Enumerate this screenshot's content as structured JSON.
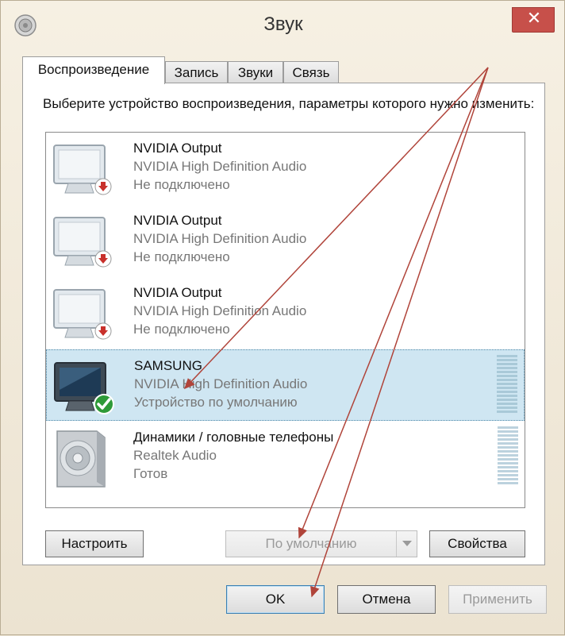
{
  "window": {
    "title": "Звук"
  },
  "tabs": [
    {
      "label": "Воспроизведение",
      "active": true
    },
    {
      "label": "Запись",
      "active": false
    },
    {
      "label": "Звуки",
      "active": false
    },
    {
      "label": "Связь",
      "active": false
    }
  ],
  "instruction": "Выберите устройство воспроизведения, параметры которого нужно изменить:",
  "devices": [
    {
      "name": "NVIDIA Output",
      "driver": "NVIDIA High Definition Audio",
      "status": "Не подключено",
      "icon": "monitor-disconnected-icon",
      "selected": false
    },
    {
      "name": "NVIDIA Output",
      "driver": "NVIDIA High Definition Audio",
      "status": "Не подключено",
      "icon": "monitor-disconnected-icon",
      "selected": false
    },
    {
      "name": "NVIDIA Output",
      "driver": "NVIDIA High Definition Audio",
      "status": "Не подключено",
      "icon": "monitor-disconnected-icon",
      "selected": false
    },
    {
      "name": "SAMSUNG",
      "driver": "NVIDIA High Definition Audio",
      "status": "Устройство по умолчанию",
      "icon": "monitor-default-icon",
      "selected": true
    },
    {
      "name": "Динамики / головные телефоны",
      "driver": "Realtek Audio",
      "status": "Готов",
      "icon": "speaker-icon",
      "selected": false
    }
  ],
  "buttons": {
    "configure": "Настроить",
    "set_default": "По умолчанию",
    "properties": "Свойства",
    "ok": "OK",
    "cancel": "Отмена",
    "apply": "Применить"
  },
  "colors": {
    "selection": "#cfe6f2",
    "close_button": "#c7504a",
    "annotation_arrow": "#b0443a"
  }
}
